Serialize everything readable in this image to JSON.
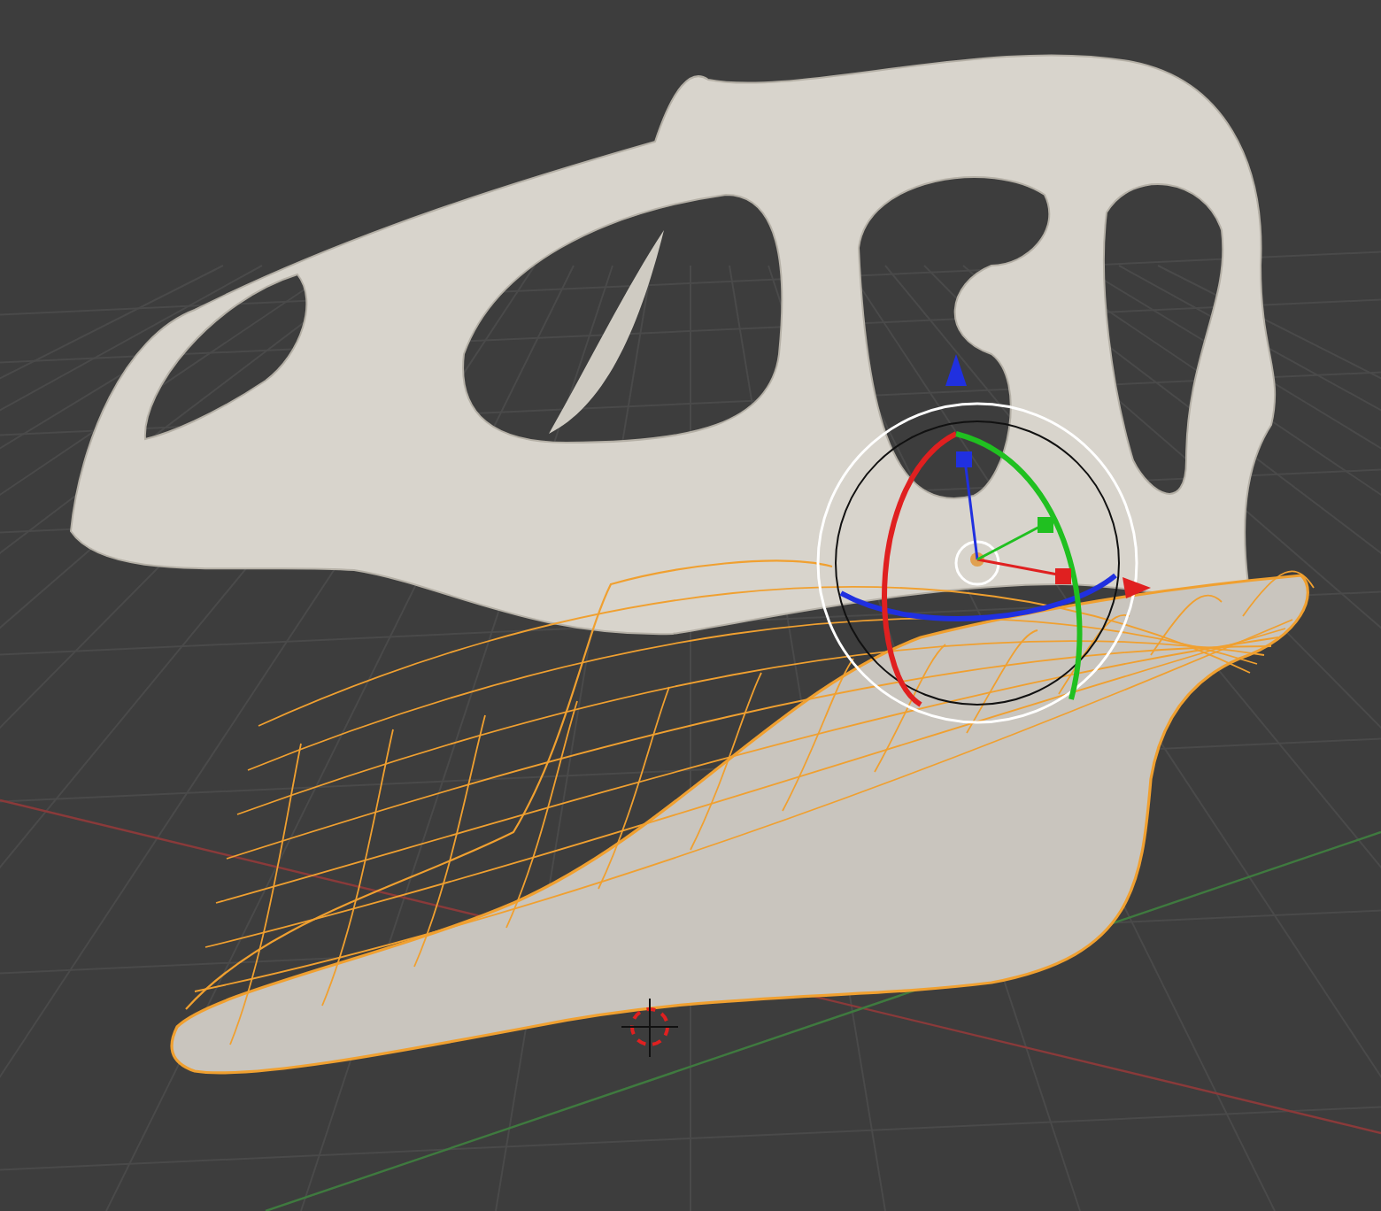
{
  "viewport": {
    "grid": true,
    "rotate_gizmo": true
  }
}
